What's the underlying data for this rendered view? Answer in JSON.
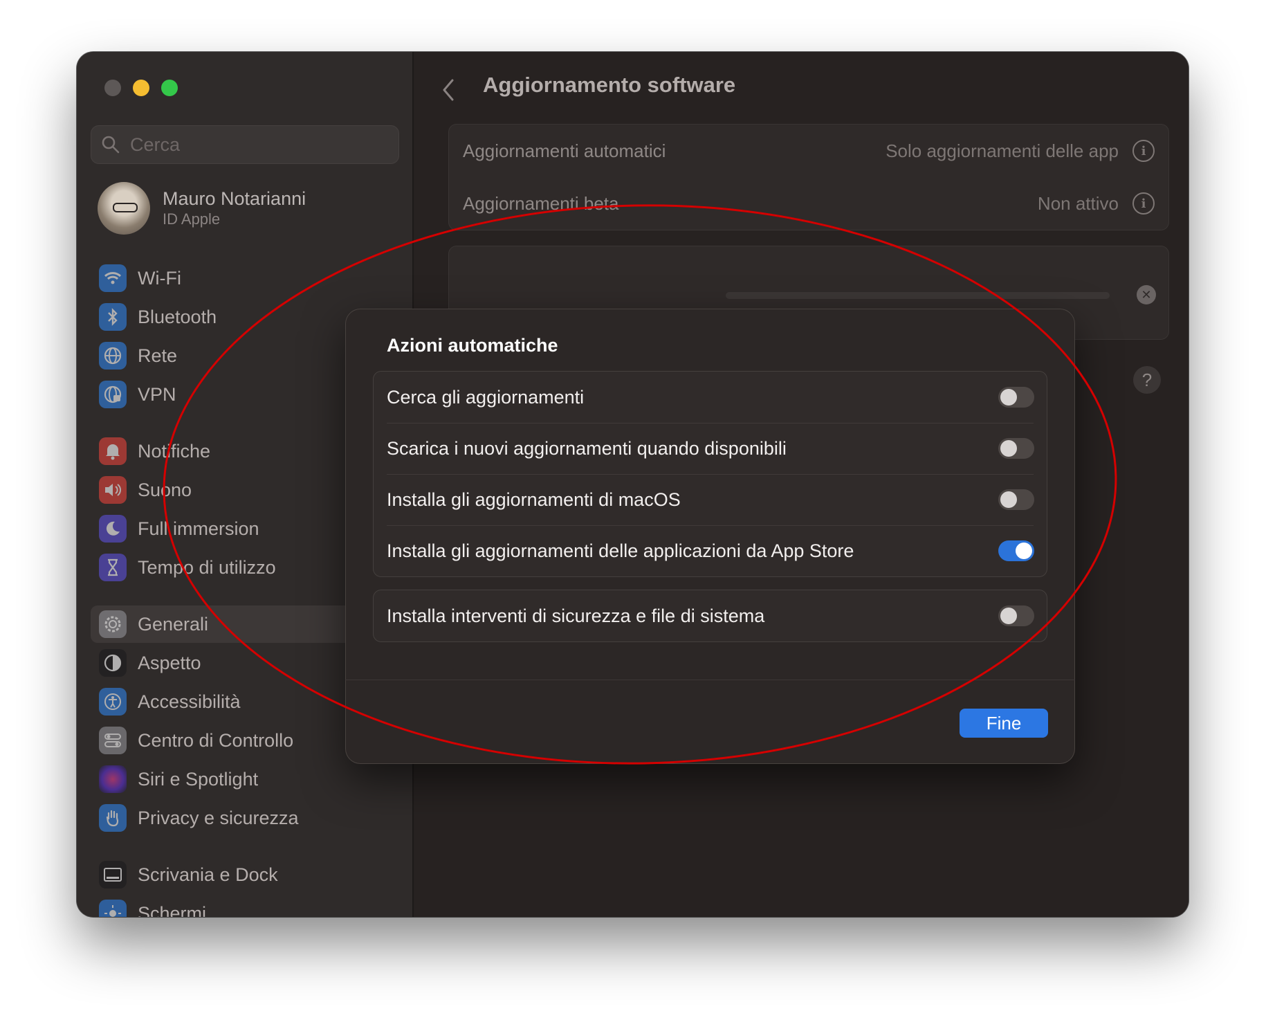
{
  "window": {
    "traffic_lights": [
      "close",
      "minimize",
      "maximize"
    ]
  },
  "sidebar": {
    "search_placeholder": "Cerca",
    "profile": {
      "name": "Mauro Notarianni",
      "subtitle": "ID Apple"
    },
    "items": [
      {
        "label": "Wi-Fi",
        "icon": "wifi-icon",
        "color": "#2f7fe0"
      },
      {
        "label": "Bluetooth",
        "icon": "bluetooth-icon",
        "color": "#2f7fe0"
      },
      {
        "label": "Rete",
        "icon": "globe-icon",
        "color": "#2f7fe0"
      },
      {
        "label": "VPN",
        "icon": "vpn-globe-icon",
        "color": "#2f7fe0"
      },
      {
        "label": "Notifiche",
        "icon": "bell-icon",
        "color": "#e0433b"
      },
      {
        "label": "Suono",
        "icon": "speaker-icon",
        "color": "#e0433b"
      },
      {
        "label": "Full immersion",
        "icon": "moon-icon",
        "color": "#5b4fd6"
      },
      {
        "label": "Tempo di utilizzo",
        "icon": "hourglass-icon",
        "color": "#5b4fd6"
      },
      {
        "label": "Generali",
        "icon": "gear-icon",
        "color": "#8e8e93",
        "selected": true
      },
      {
        "label": "Aspetto",
        "icon": "appearance-icon",
        "color": "#1c1c1e"
      },
      {
        "label": "Accessibilità",
        "icon": "accessibility-icon",
        "color": "#2f7fe0"
      },
      {
        "label": "Centro di Controllo",
        "icon": "switches-icon",
        "color": "#8e8e93"
      },
      {
        "label": "Siri e Spotlight",
        "icon": "siri-icon",
        "color": "#b04fd6"
      },
      {
        "label": "Privacy e sicurezza",
        "icon": "hand-icon",
        "color": "#2f7fe0"
      },
      {
        "label": "Scrivania e Dock",
        "icon": "dock-icon",
        "color": "#1c1c1e"
      },
      {
        "label": "Schermi",
        "icon": "sun-icon",
        "color": "#2f7fe0"
      }
    ]
  },
  "main": {
    "title": "Aggiornamento software",
    "settings": [
      {
        "label": "Aggiornamenti automatici",
        "value": "Solo aggiornamenti delle app"
      },
      {
        "label": "Aggiornamenti beta",
        "value": "Non attivo"
      }
    ],
    "help_label": "?",
    "info_label": "i",
    "cancel_label": "✕"
  },
  "modal": {
    "title": "Azioni automatiche",
    "toggles": [
      {
        "label": "Cerca gli aggiornamenti",
        "on": false
      },
      {
        "label": "Scarica i nuovi aggiornamenti quando disponibili",
        "on": false
      },
      {
        "label": "Installa gli aggiornamenti di macOS",
        "on": false
      },
      {
        "label": "Installa gli aggiornamenti delle applicazioni da App Store",
        "on": true
      }
    ],
    "security_toggle": {
      "label": "Installa interventi di sicurezza e file di sistema",
      "on": false
    },
    "done_label": "Fine"
  },
  "annotation": {
    "shape": "ellipse",
    "color": "#d40000"
  }
}
